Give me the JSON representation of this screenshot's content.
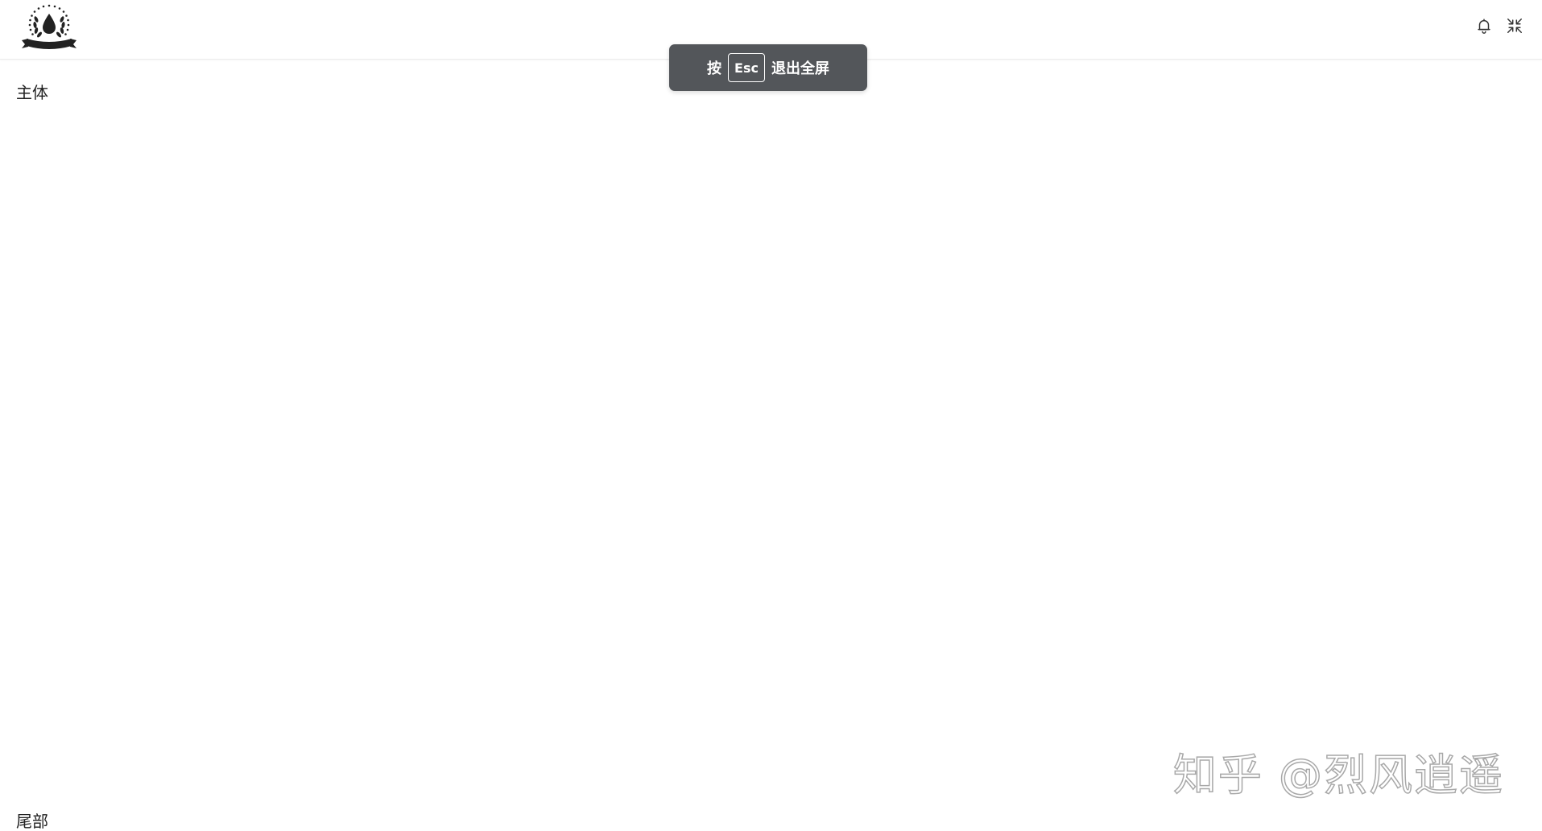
{
  "header": {
    "logo_icon": "droplet-laurel-badge-icon",
    "notifications_icon": "bell-icon",
    "exit_fullscreen_icon": "compress-arrows-icon"
  },
  "main": {
    "label": "主体"
  },
  "footer": {
    "label": "尾部"
  },
  "fullscreen_toast": {
    "prefix": "按",
    "key": "Esc",
    "suffix": "退出全屏"
  },
  "watermark": {
    "text": "知乎 @烈风逍遥"
  },
  "colors": {
    "toast_bg": "#53565a",
    "icon": "#333333",
    "background": "#ffffff"
  }
}
